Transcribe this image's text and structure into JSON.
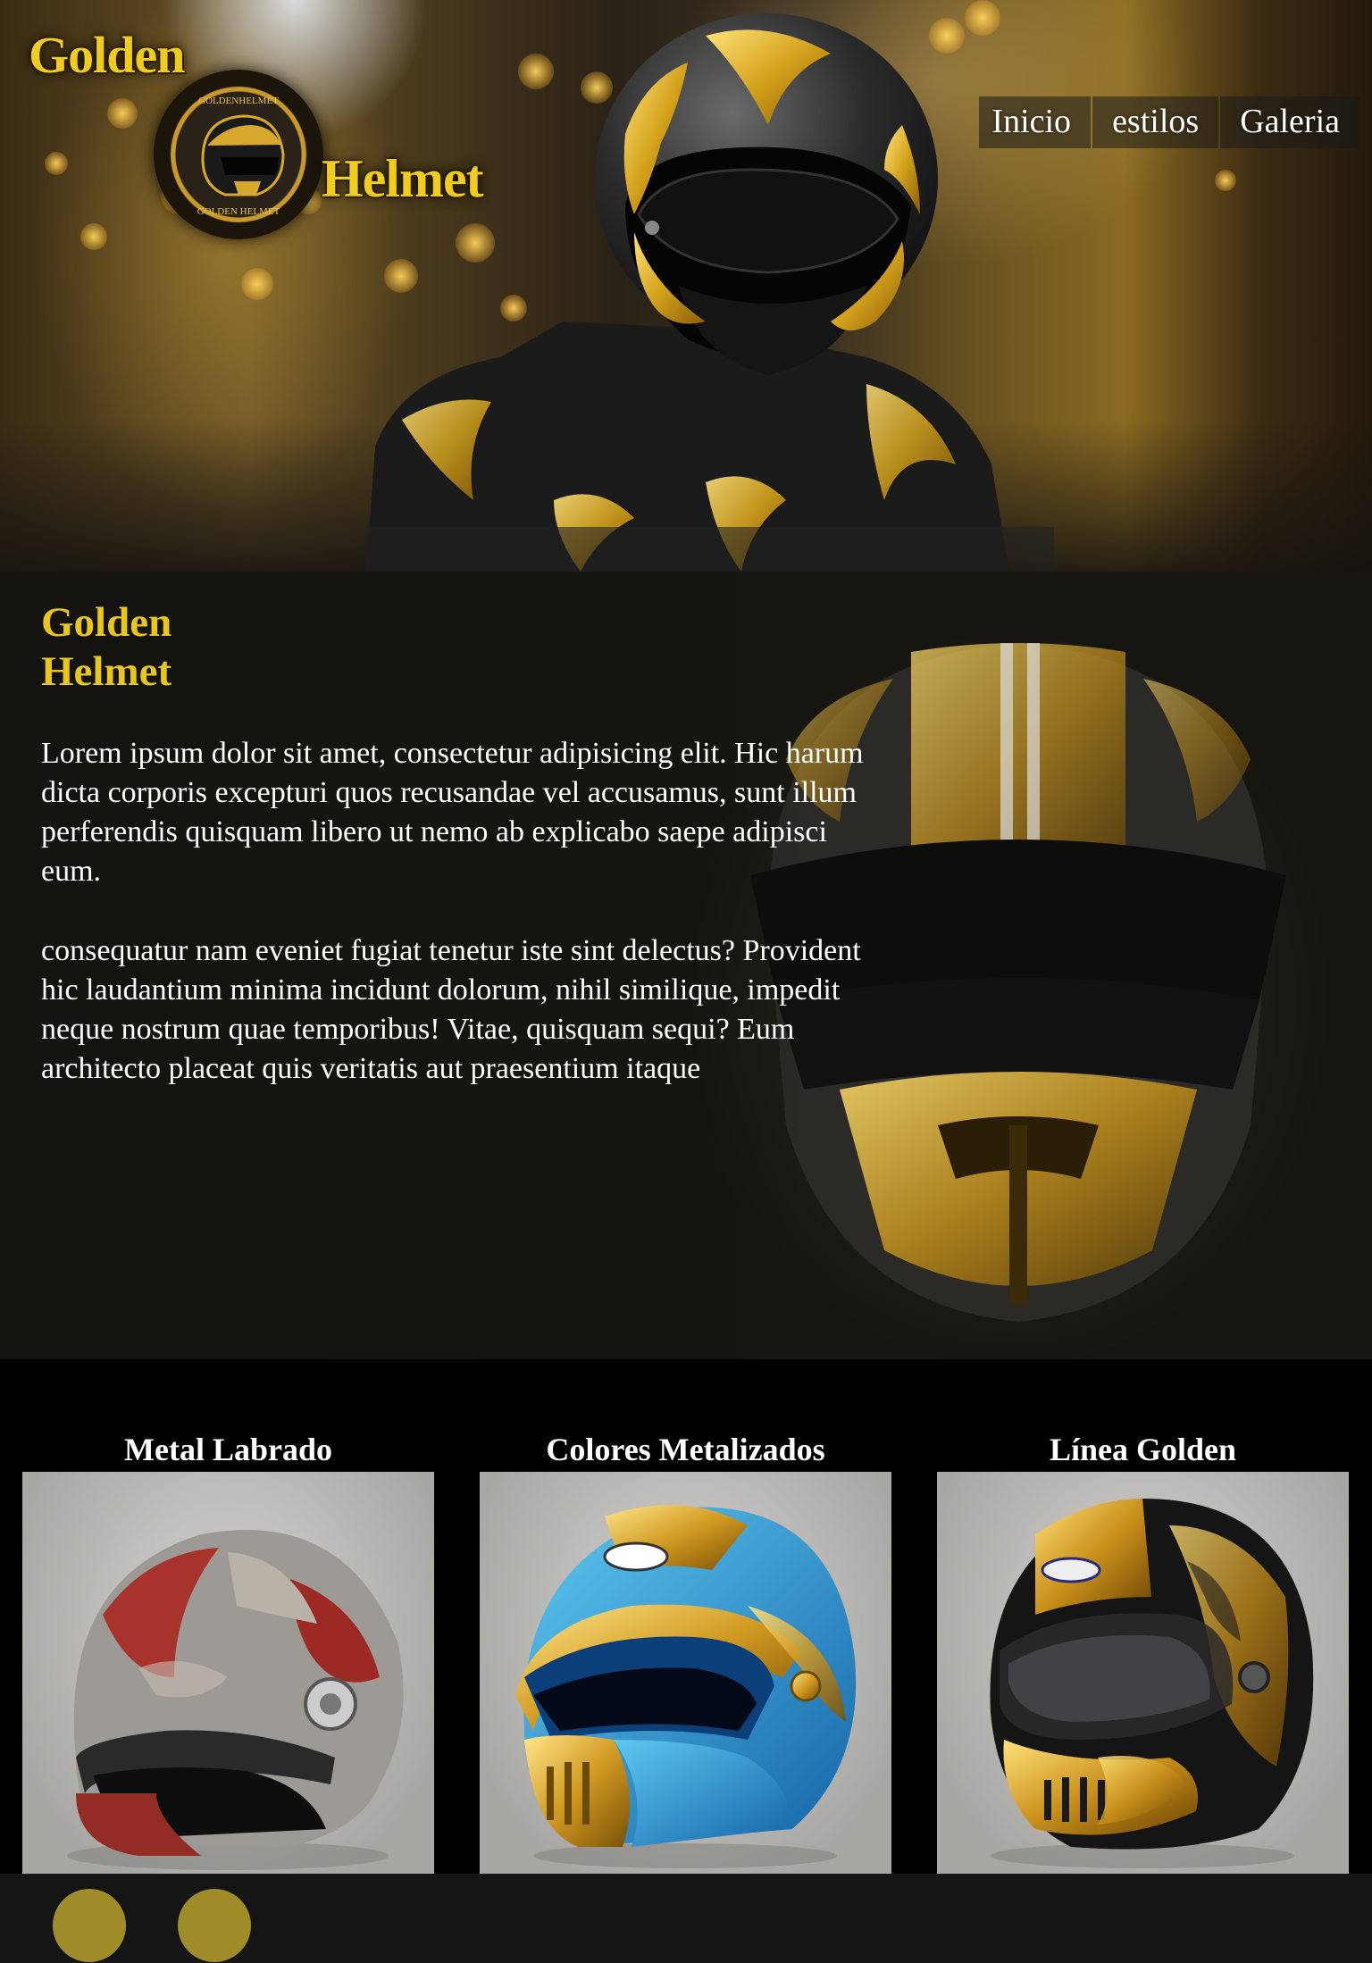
{
  "brand": {
    "logo_word_top": "Golden",
    "logo_word_bottom": "Helmet",
    "badge_text_top": "GOLDENHELMET",
    "badge_text_bottom": "GOLDEN HELMET",
    "color_gold": "#e9c61a"
  },
  "nav": {
    "items": [
      {
        "label": "Inicio"
      },
      {
        "label": "estilos"
      },
      {
        "label": "Galeria"
      }
    ]
  },
  "about": {
    "title_line1": "Golden",
    "title_line2": "Helmet",
    "paragraph1": "Lorem ipsum dolor sit amet, consectetur adipisicing elit. Hic harum dicta corporis excepturi quos recusandae vel accusamus, sunt illum perferendis quisquam libero ut nemo ab explicabo saepe adipisci eum.",
    "paragraph2": "consequatur nam eveniet fugiat tenetur iste sint delectus? Provident hic laudantium minima incidunt dolorum, nihil similique, impedit neque nostrum quae temporibus! Vitae, quisquam sequi? Eum architecto placeat quis veritatis aut praesentium itaque"
  },
  "gallery": {
    "cards": [
      {
        "title": "Metal Labrado",
        "image": "engraved-silver-red-helmet"
      },
      {
        "title": "Colores Metalizados",
        "image": "blue-gold-fullface-helmet"
      },
      {
        "title": "Línea Golden",
        "image": "black-gold-fullface-helmet"
      }
    ]
  },
  "footer": {
    "social_color": "#a08d2a",
    "icons": [
      "social-icon-1",
      "social-icon-2"
    ]
  }
}
